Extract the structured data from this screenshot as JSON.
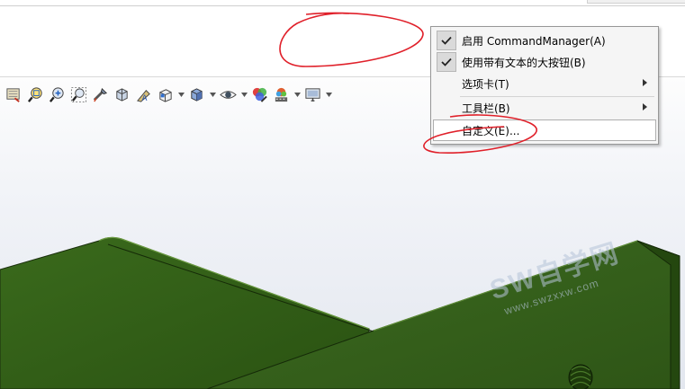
{
  "toolbar": {
    "icons": [
      {
        "name": "section-view-icon"
      },
      {
        "name": "zoom-to-fit-icon"
      },
      {
        "name": "zoom-to-area-icon"
      },
      {
        "name": "zoom-to-selection-icon"
      },
      {
        "name": "rotate-view-icon"
      },
      {
        "name": "previous-view-icon"
      },
      {
        "name": "dynamic-annotation-icon"
      },
      {
        "name": "view-orientation-icon"
      },
      {
        "name": "display-style-icon"
      },
      {
        "name": "hide-show-items-icon"
      },
      {
        "name": "edit-appearance-icon"
      },
      {
        "name": "apply-scene-icon"
      },
      {
        "name": "view-settings-icon"
      }
    ]
  },
  "context_menu": {
    "items": [
      {
        "label": "启用 CommandManager(A)",
        "checked": true,
        "submenu": false
      },
      {
        "label": "使用带有文本的大按钮(B)",
        "checked": true,
        "submenu": false
      },
      {
        "label": "选项卡(T)",
        "checked": false,
        "submenu": true
      },
      {
        "label": "工具栏(B)",
        "checked": false,
        "submenu": true
      },
      {
        "label": "自定义(E)...",
        "checked": false,
        "submenu": false,
        "highlighted": true
      }
    ]
  },
  "watermark": {
    "title": "SW自学网",
    "url": "www.swzxxw.com"
  },
  "colors": {
    "model_green": "#2f5a16",
    "annotation_red": "#e0202a",
    "menu_bg": "#f5f5f5"
  }
}
